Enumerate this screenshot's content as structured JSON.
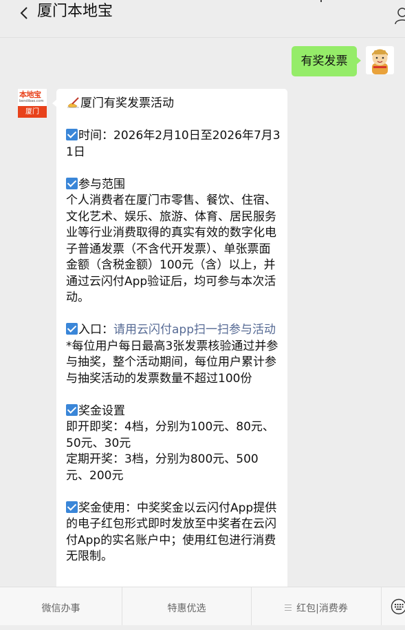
{
  "header": {
    "back_icon": "chevron-left-icon",
    "title": "厦门本地宝",
    "profile_icon": "user-icon"
  },
  "chat": {
    "user_message": "有奖发票",
    "user_avatar_icon": "cartoon-monk-avatar",
    "account_avatar": {
      "logo_text": "本地宝",
      "logo_url": "bendibao.com",
      "city": "厦门"
    },
    "reply": {
      "title": "厦门有奖发票活动",
      "time_label": "时间：",
      "time_value": "2026年2月10日至2026年7月31日",
      "scope_title": "参与范围",
      "scope_text": "个人消费者在厦门市零售、餐饮、住宿、文化艺术、娱乐、旅游、体育、居民服务业等行业消费取得的真实有效的数字化电子普通发票（不含代开发票）、单张票面金额（含税金额）100元（含）以上，并通过云闪付App验证后，均可参与本次活动。",
      "entry_label": "入口：",
      "entry_link": "请用云闪付app扫一扫参与活动",
      "note": "*每位用户每日最高3张发票核验通过并参与抽奖，整个活动期间，每位用户累计参与抽奖活动的发票数量不超过100份",
      "prize_title": "奖金设置",
      "instant_prize": "即开即奖：4档，分别为100元、80元、50元、30元",
      "periodic_prize": "定期开奖：3档，分别为800元、500元、200元",
      "usage": "奖金使用：中奖奖金以云闪付App提供的电子红包形式即时发放至中奖者在云闪付App的实名账户中；使用红包进行消费无限制。"
    }
  },
  "bottom_menu": {
    "items": [
      {
        "label": "微信办事"
      },
      {
        "label": "特惠优选"
      },
      {
        "label": "红包|消费券",
        "icon": "menu-lines-icon"
      }
    ],
    "keyboard_icon": "keyboard-icon"
  },
  "colors": {
    "background": "#ededed",
    "user_bubble": "#95ec69",
    "link": "#576b95",
    "check": "#3a86d8",
    "brand": "#e8421b"
  }
}
